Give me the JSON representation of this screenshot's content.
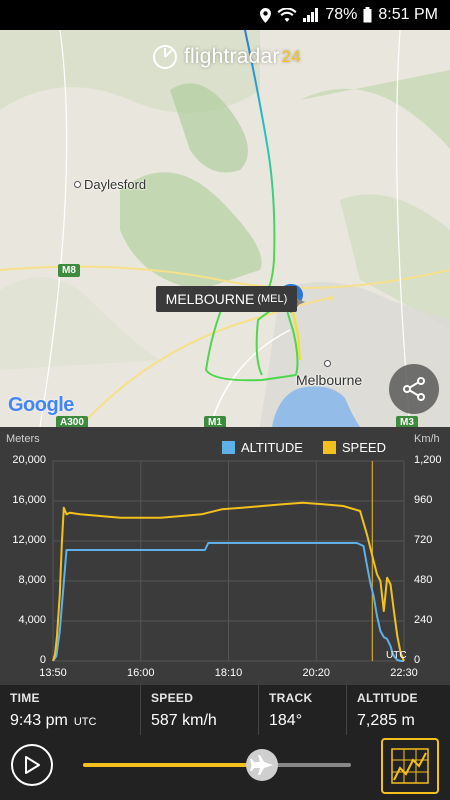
{
  "status_bar": {
    "battery": "78%",
    "time": "8:51 PM"
  },
  "map": {
    "logo_text": "flightradar",
    "logo_num": "24",
    "places": {
      "daylesford": "Daylesford",
      "melbourne": "Melbourne"
    },
    "roads": {
      "m8": "M8",
      "a300": "A300",
      "m1": "M1",
      "m3": "M3"
    },
    "airport_name": "MELBOURNE",
    "airport_code": "(MEL)",
    "attribution": "Google"
  },
  "chart": {
    "left_unit": "Meters",
    "right_unit": "Km/h",
    "legend": {
      "altitude": "ALTITUDE",
      "speed": "SPEED"
    },
    "colors": {
      "altitude": "#5fb0e6",
      "speed": "#f3c11d",
      "panel": "#3b3b3b",
      "grid": "#555555"
    },
    "utc_label": "UTC",
    "y_left_ticks": [
      "20,000",
      "16,000",
      "12,000",
      "8,000",
      "4,000",
      "0"
    ],
    "y_right_ticks": [
      "1,200",
      "960",
      "720",
      "480",
      "240",
      "0"
    ],
    "x_ticks": [
      "13:50",
      "16:00",
      "18:10",
      "20:20",
      "22:30"
    ]
  },
  "chart_data": {
    "type": "line",
    "xlabel": "",
    "ylabel": "Meters",
    "y2label": "Km/h",
    "x_ticks": [
      "13:50",
      "16:00",
      "18:10",
      "20:20",
      "22:30"
    ],
    "x_domain_minutes": [
      830,
      1350
    ],
    "ylim": [
      0,
      20000
    ],
    "y2lim": [
      0,
      1200
    ],
    "grid": true,
    "legend": "top",
    "cursor_time": "21:43",
    "series": [
      {
        "name": "ALTITUDE",
        "axis": "left",
        "x_minutes": [
          830,
          835,
          840,
          845,
          850,
          860,
          900,
          1000,
          1055,
          1060,
          1100,
          1200,
          1280,
          1290,
          1295,
          1300,
          1305,
          1310,
          1315,
          1320,
          1325,
          1330,
          1333,
          1336,
          1340,
          1345,
          1350
        ],
        "values": [
          0,
          500,
          3000,
          7000,
          11100,
          11100,
          11100,
          11100,
          11100,
          11800,
          11800,
          11800,
          11800,
          11500,
          9600,
          7800,
          6500,
          4500,
          3000,
          2400,
          2200,
          1500,
          800,
          400,
          100,
          0,
          0
        ]
      },
      {
        "name": "SPEED",
        "axis": "right",
        "x_minutes": [
          830,
          833,
          836,
          840,
          843,
          846,
          850,
          855,
          870,
          900,
          930,
          960,
          990,
          1020,
          1050,
          1080,
          1110,
          1140,
          1170,
          1200,
          1230,
          1260,
          1285,
          1290,
          1295,
          1300,
          1305,
          1310,
          1315,
          1320,
          1325,
          1330,
          1335,
          1340,
          1345,
          1350
        ],
        "values": [
          0,
          40,
          150,
          400,
          700,
          920,
          880,
          890,
          880,
          870,
          860,
          860,
          860,
          870,
          880,
          910,
          920,
          930,
          940,
          950,
          940,
          930,
          900,
          830,
          760,
          680,
          600,
          520,
          480,
          300,
          500,
          460,
          300,
          150,
          50,
          0
        ]
      }
    ]
  },
  "info": {
    "time_label": "TIME",
    "time_value": "9:43 pm",
    "time_unit": "UTC",
    "speed_label": "SPEED",
    "speed_value": "587 km/h",
    "track_label": "TRACK",
    "track_value": "184°",
    "altitude_label": "ALTITUDE",
    "altitude_value": "7,285 m"
  },
  "playback": {
    "progress": 0.6685
  }
}
